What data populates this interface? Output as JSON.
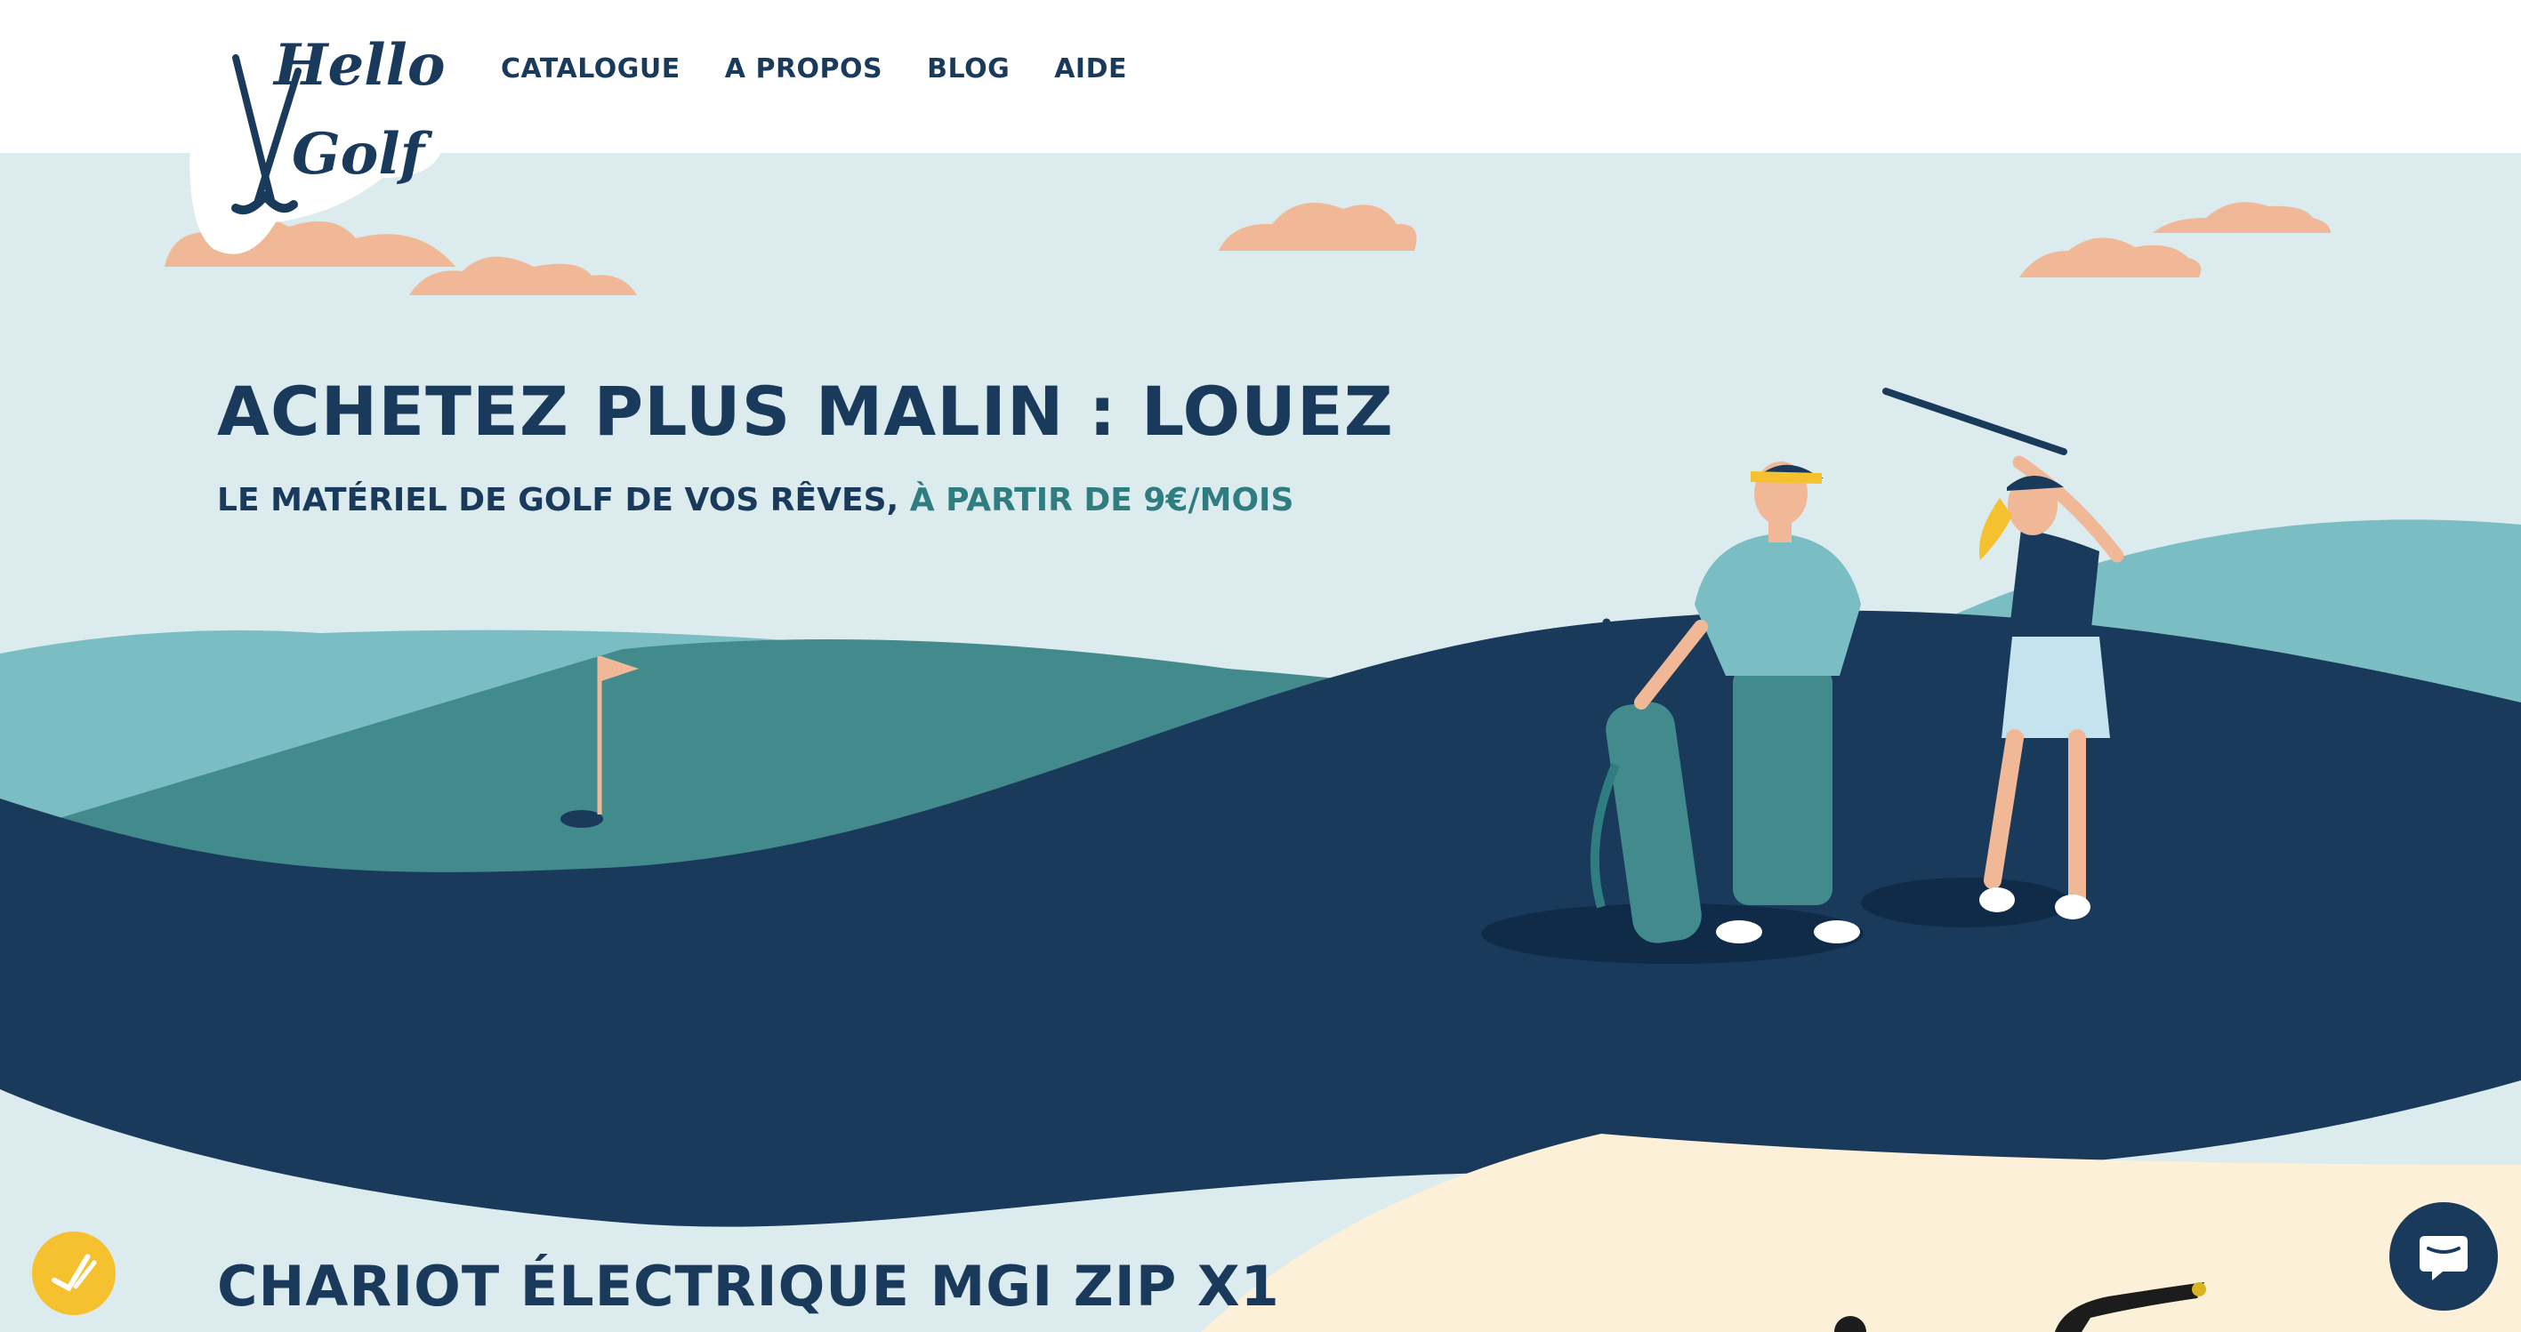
{
  "logo": {
    "line1": "Hello",
    "line2": "Golf"
  },
  "nav": {
    "items": [
      "CATALOGUE",
      "A PROPOS",
      "BLOG",
      "AIDE"
    ]
  },
  "hero": {
    "title": "ACHETEZ PLUS MALIN : LOUEZ",
    "subtitle": "LE MATÉRIEL DE GOLF DE VOS RÊVES,",
    "subtitle_highlight": "À PARTIR DE 9€/MOIS"
  },
  "product": {
    "title": "CHARIOT ÉLECTRIQUE MGI ZIP X1"
  },
  "colors": {
    "navy": "#1a3a5c",
    "teal": "#2f7d80",
    "sky": "#dcebee",
    "cloud": "#f0b896",
    "sand": "#fdf0d8",
    "badge": "#f6c12e"
  },
  "icons": {
    "badge": "checkmark-badge-icon",
    "chat": "chat-bubble-icon"
  }
}
